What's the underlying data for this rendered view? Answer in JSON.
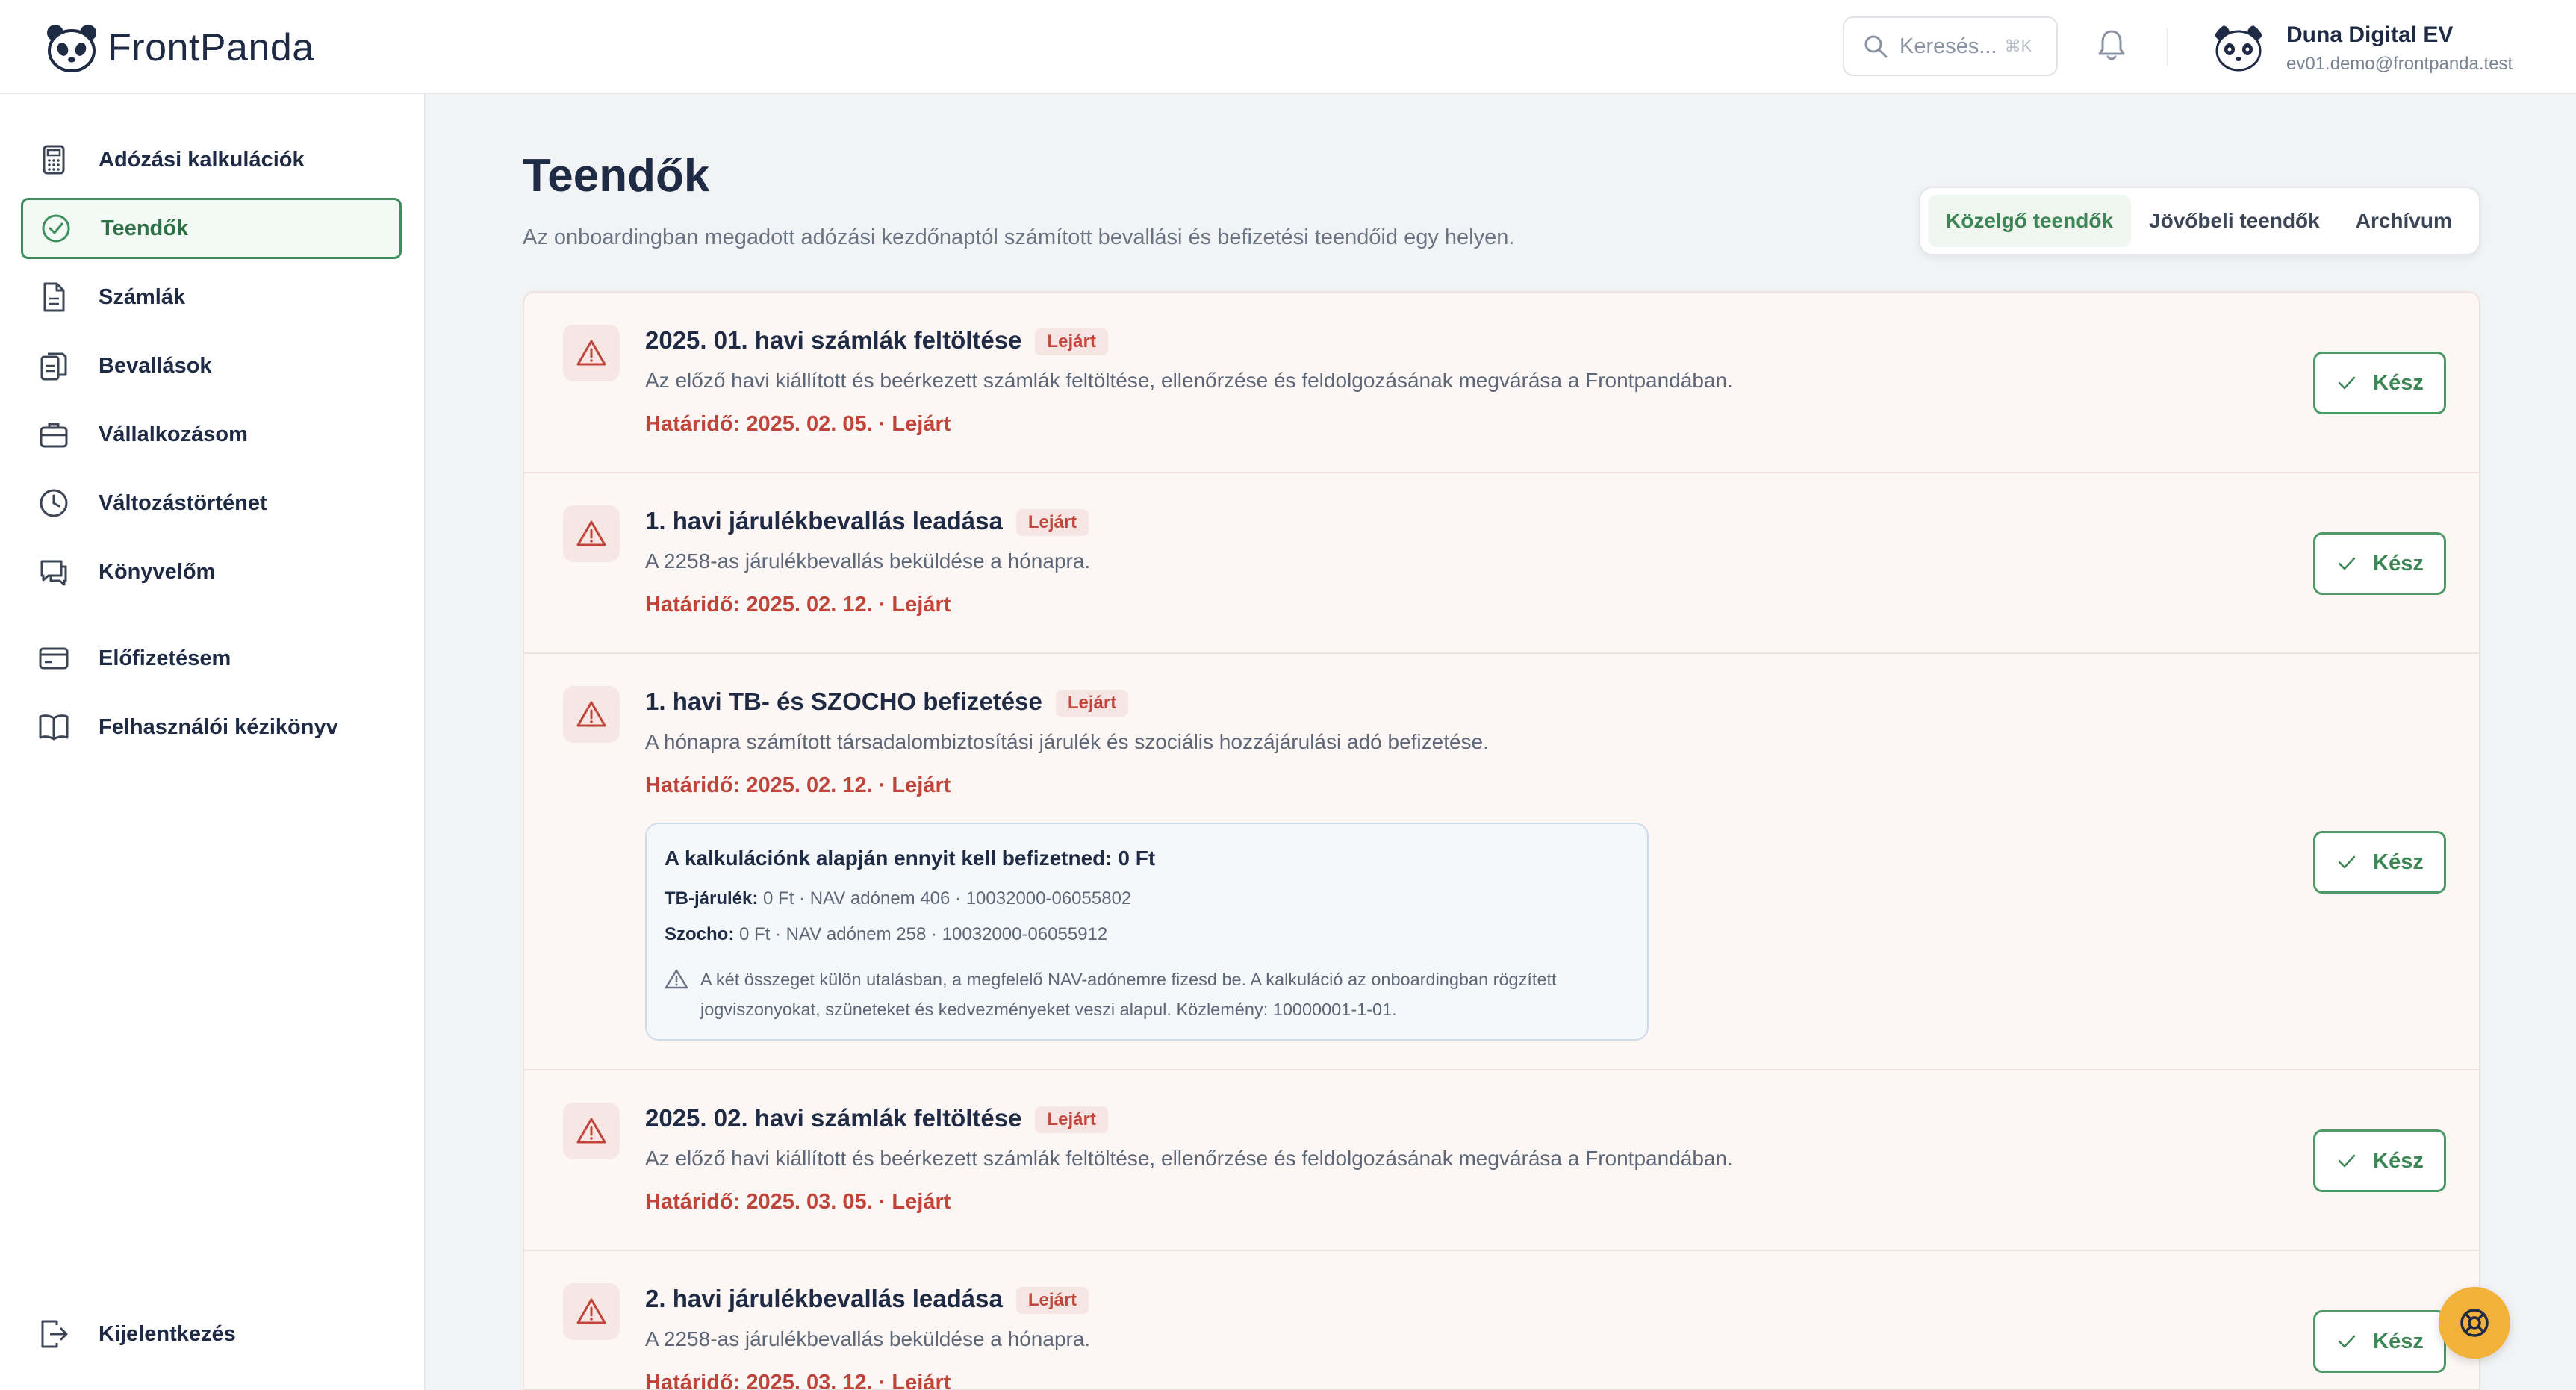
{
  "brand": {
    "name": "FrontPanda"
  },
  "header": {
    "search_placeholder": "Keresés...",
    "search_shortcut": "⌘K",
    "user_name": "Duna Digital EV",
    "user_email": "ev01.demo@frontpanda.test"
  },
  "sidebar": {
    "items": [
      {
        "label": "Adózási kalkulációk",
        "icon": "calculator-icon"
      },
      {
        "label": "Teendők",
        "icon": "check-circle-icon",
        "active": true
      },
      {
        "label": "Számlák",
        "icon": "document-icon"
      },
      {
        "label": "Bevallások",
        "icon": "clipboard-icon"
      },
      {
        "label": "Vállalkozásom",
        "icon": "briefcase-icon"
      },
      {
        "label": "Változástörténet",
        "icon": "clock-icon"
      },
      {
        "label": "Könyvelőm",
        "icon": "chat-icon"
      },
      {
        "label": "Előfizetésem",
        "icon": "credit-card-icon"
      },
      {
        "label": "Felhasználói kézikönyv",
        "icon": "book-icon"
      }
    ],
    "logout_label": "Kijelentkezés"
  },
  "main": {
    "title": "Teendők",
    "subtitle": "Az onboardingban megadott adózási kezdőnaptól számított bevallási és befizetési teendőid egy helyen.",
    "tabs": [
      {
        "label": "Közelgő teendők",
        "active": true
      },
      {
        "label": "Jövőbeli teendők"
      },
      {
        "label": "Archívum"
      }
    ],
    "done_label": "Kész",
    "tasks": [
      {
        "title": "2025. 01. havi számlák feltöltése",
        "badge": "Lejárt",
        "description": "Az előző havi kiállított és beérkezett számlák feltöltése, ellenőrzése és feldolgozásának megvárása a Frontpandában.",
        "due": "Határidő: 2025. 02. 05. · Lejárt"
      },
      {
        "title": "1. havi járulékbevallás leadása",
        "badge": "Lejárt",
        "description": "A 2258-as járulékbevallás beküldése a hónapra.",
        "due": "Határidő: 2025. 02. 12. · Lejárt"
      },
      {
        "title": "1. havi TB- és SZOCHO befizetése",
        "badge": "Lejárt",
        "description": "A hónapra számított társadalombiztosítási járulék és szociális hozzájárulási adó befizetése.",
        "due": "Határidő: 2025. 02. 12. · Lejárt",
        "calc": {
          "title": "A kalkulációnk alapján ennyit kell befizetned: 0 Ft",
          "tb_label": "TB-járulék:",
          "tb_value": "0 Ft · NAV adónem 406 · 10032000-06055802",
          "szocho_label": "Szocho:",
          "szocho_value": "0 Ft · NAV adónem 258 · 10032000-06055912",
          "note": "A két összeget külön utalásban, a megfelelő NAV-adónemre fizesd be. A kalkuláció az onboardingban rögzített jogviszonyokat, szüneteket és kedvezményeket veszi alapul. Közlemény: 10000001-1-01."
        }
      },
      {
        "title": "2025. 02. havi számlák feltöltése",
        "badge": "Lejárt",
        "description": "Az előző havi kiállított és beérkezett számlák feltöltése, ellenőrzése és feldolgozásának megvárása a Frontpandában.",
        "due": "Határidő: 2025. 03. 05. · Lejárt"
      },
      {
        "title": "2. havi járulékbevallás leadása",
        "badge": "Lejárt",
        "description": "A 2258-as járulékbevallás beküldése a hónapra.",
        "due": "Határidő: 2025. 03. 12. · Lejárt"
      }
    ]
  },
  "colors": {
    "accent_green": "#3b8654",
    "danger_red": "#c1443a",
    "fab_yellow": "#f2b23a"
  }
}
